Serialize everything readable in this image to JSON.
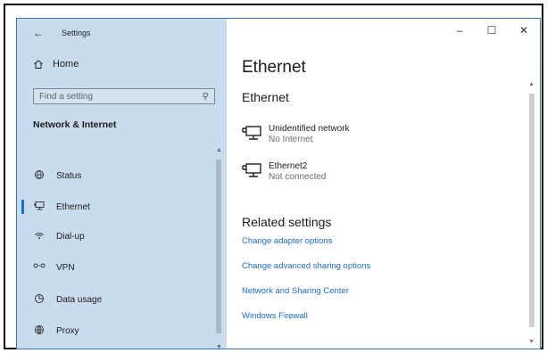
{
  "window": {
    "title": "Settings",
    "controls": {
      "minimize": "–",
      "maximize": "☐",
      "close": "✕"
    }
  },
  "sidebar": {
    "back_icon": "arrow-left-icon",
    "home_label": "Home",
    "search_placeholder": "Find a setting",
    "section_title": "Network & Internet",
    "items": [
      {
        "label": "Status",
        "icon": "globe-icon"
      },
      {
        "label": "Ethernet",
        "icon": "ethernet-icon",
        "selected": true
      },
      {
        "label": "Dial-up",
        "icon": "dialup-icon"
      },
      {
        "label": "VPN",
        "icon": "vpn-icon"
      },
      {
        "label": "Data usage",
        "icon": "data-usage-icon"
      },
      {
        "label": "Proxy",
        "icon": "globe-proxy-icon"
      }
    ]
  },
  "main": {
    "page_title": "Ethernet",
    "section_title": "Ethernet",
    "networks": [
      {
        "name": "Unidentified network",
        "status": "No Internet"
      },
      {
        "name": "Ethernet2",
        "status": "Not connected"
      }
    ],
    "related_title": "Related settings",
    "links": [
      "Change adapter options",
      "Change advanced sharing options",
      "Network and Sharing Center",
      "Windows Firewall"
    ]
  },
  "colors": {
    "sidebar_bg": "#c9dced",
    "link": "#1a6dc2",
    "accent": "#1f6fc0"
  }
}
